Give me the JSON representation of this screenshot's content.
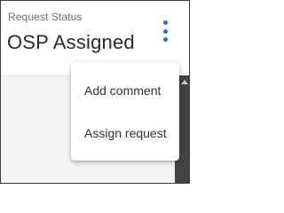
{
  "header": {
    "label": "Request Status",
    "value": "OSP Assigned"
  },
  "menu_button": {
    "icon": "more-vert-icon",
    "color": "#1f6fd6"
  },
  "menu": {
    "items": [
      {
        "label": "Add comment"
      },
      {
        "label": "Assign request"
      }
    ]
  },
  "colors": {
    "accent": "#1f6fd6"
  }
}
